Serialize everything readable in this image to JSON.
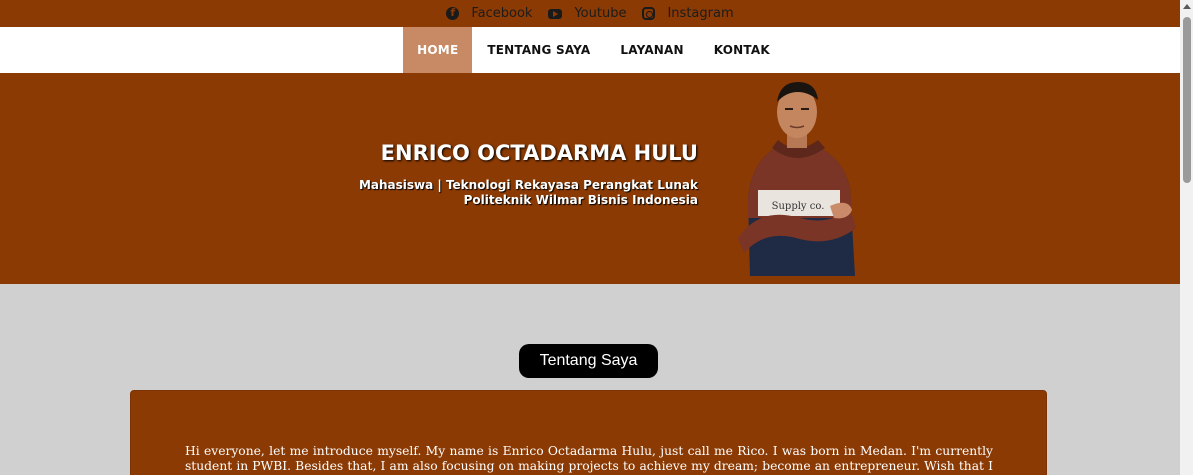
{
  "topbar": {
    "links": [
      {
        "label": "Facebook",
        "icon": "facebook-icon"
      },
      {
        "label": "Youtube",
        "icon": "youtube-icon"
      },
      {
        "label": "Instagram",
        "icon": "instagram-icon"
      }
    ]
  },
  "nav": {
    "items": [
      {
        "label": "HOME",
        "active": true
      },
      {
        "label": "TENTANG SAYA",
        "active": false
      },
      {
        "label": "LAYANAN",
        "active": false
      },
      {
        "label": "KONTAK",
        "active": false
      }
    ]
  },
  "hero": {
    "name": "ENRICO OCTADARMA HULU",
    "subtitle_line1": "Mahasiswa | Teknologi Rekayasa Perangkat Lunak",
    "subtitle_line2": "Politeknik Wilmar Bisnis Indonesia",
    "photo_shirt_text": "Supply co."
  },
  "about": {
    "heading": "Tentang Saya",
    "text": "Hi everyone, let me introduce myself. My name is Enrico Octadarma Hulu, just call me Rico. I was born in Medan. I'm currently student in PWBI. Besides that, I am also focusing on making projects to achieve my dream; become an entrepreneur. Wish that I can make my dream come true."
  },
  "colors": {
    "brand_brown": "#8b3a04",
    "nav_active": "#c88a64",
    "page_bg": "#d0d0d0"
  }
}
